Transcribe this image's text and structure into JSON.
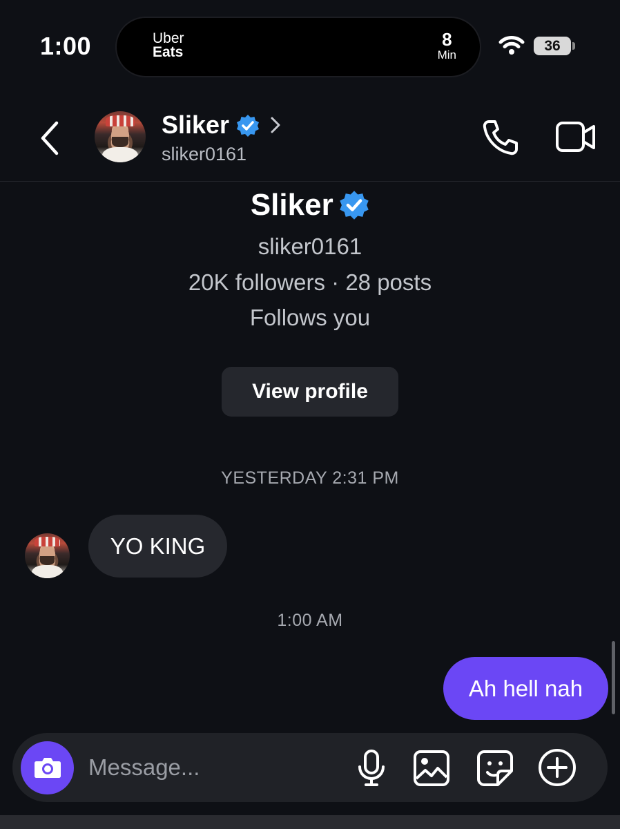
{
  "status_bar": {
    "time": "1:00",
    "live_activity": {
      "brand_line1": "Uber",
      "brand_line2": "Eats",
      "eta_value": "8",
      "eta_unit": "Min"
    },
    "battery": "36"
  },
  "header": {
    "name": "Sliker",
    "username": "sliker0161",
    "verified": true,
    "icons": [
      "back-icon",
      "verified-badge-icon",
      "chevron-right-icon",
      "phone-icon",
      "video-icon"
    ]
  },
  "profile": {
    "name": "Sliker",
    "username": "sliker0161",
    "stats": "20K followers · 28 posts",
    "follows_you": "Follows you",
    "view_profile_label": "View profile"
  },
  "messages": [
    {
      "timestamp": "YESTERDAY 2:31 PM",
      "direction": "incoming",
      "text": "YO KING"
    },
    {
      "timestamp": "1:00 AM",
      "direction": "outgoing",
      "text": "Ah hell nah"
    }
  ],
  "composer": {
    "placeholder": "Message...",
    "icons": [
      "camera-icon",
      "microphone-icon",
      "gallery-icon",
      "sticker-icon",
      "plus-icon"
    ]
  },
  "colors": {
    "background": "#0e1015",
    "accent": "#6b47f5",
    "incoming_bubble": "#26282e",
    "verified": "#3897f0"
  }
}
